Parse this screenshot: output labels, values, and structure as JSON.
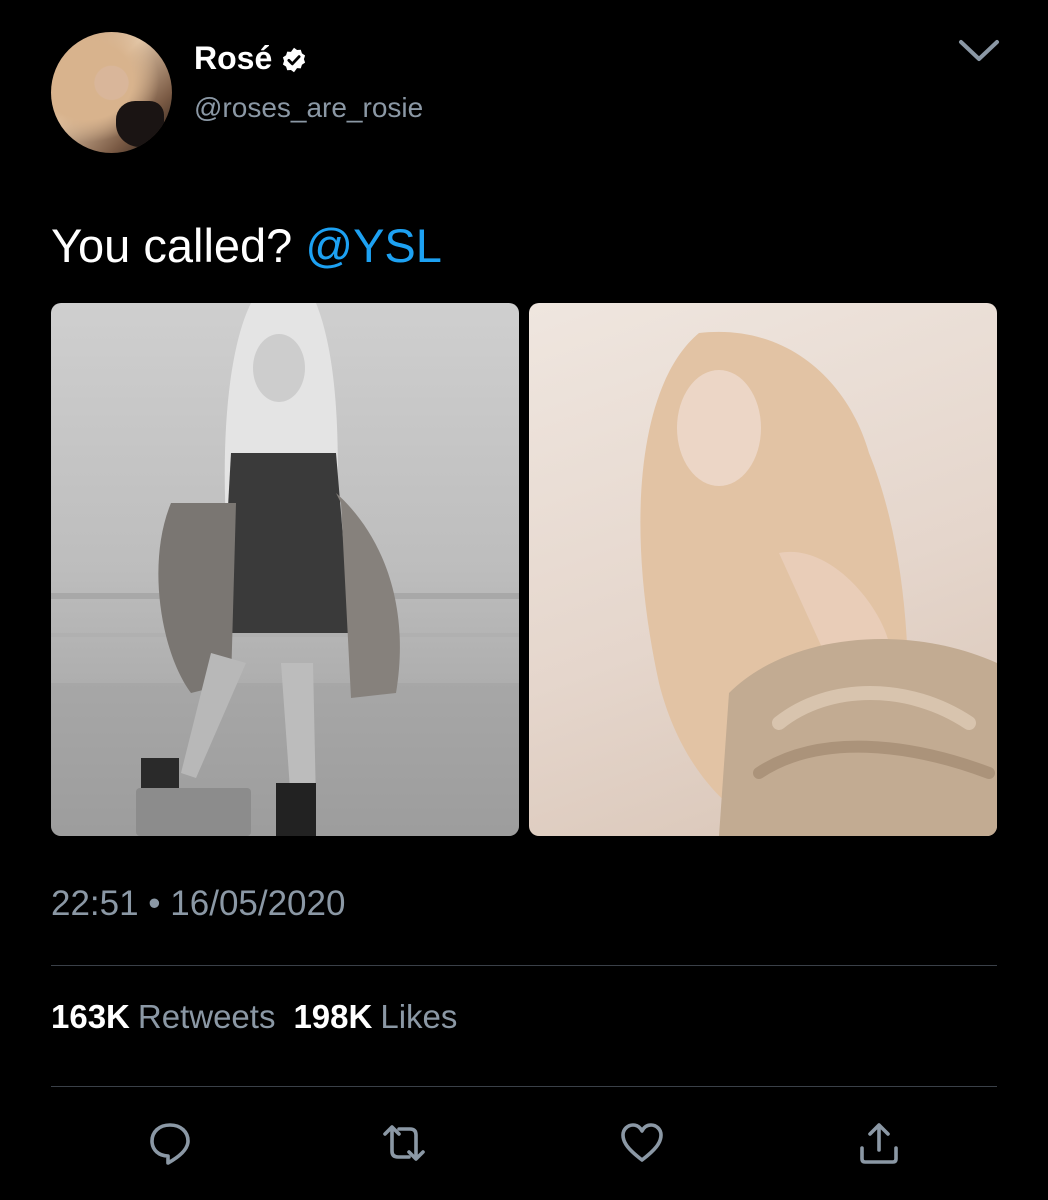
{
  "author": {
    "display_name": "Rosé",
    "handle": "@roses_are_rosie",
    "verified": true
  },
  "tweet": {
    "text": "You called? ",
    "mention": "@YSL"
  },
  "media": [
    {
      "description_icon": "photo-grayscale"
    },
    {
      "description_icon": "photo-warm-tone"
    }
  ],
  "meta": {
    "timestamp": "22:51 • 16/05/2020"
  },
  "stats": {
    "retweets_count": "163K",
    "retweets_label": "Retweets",
    "likes_count": "198K",
    "likes_label": "Likes"
  },
  "actions": {
    "reply_icon": "reply-icon",
    "retweet_icon": "retweet-icon",
    "like_icon": "heart-icon",
    "share_icon": "share-icon"
  },
  "colors": {
    "background": "#000000",
    "secondary_text": "#8b98a5",
    "link": "#1da1f2",
    "divider": "#3a4048"
  }
}
